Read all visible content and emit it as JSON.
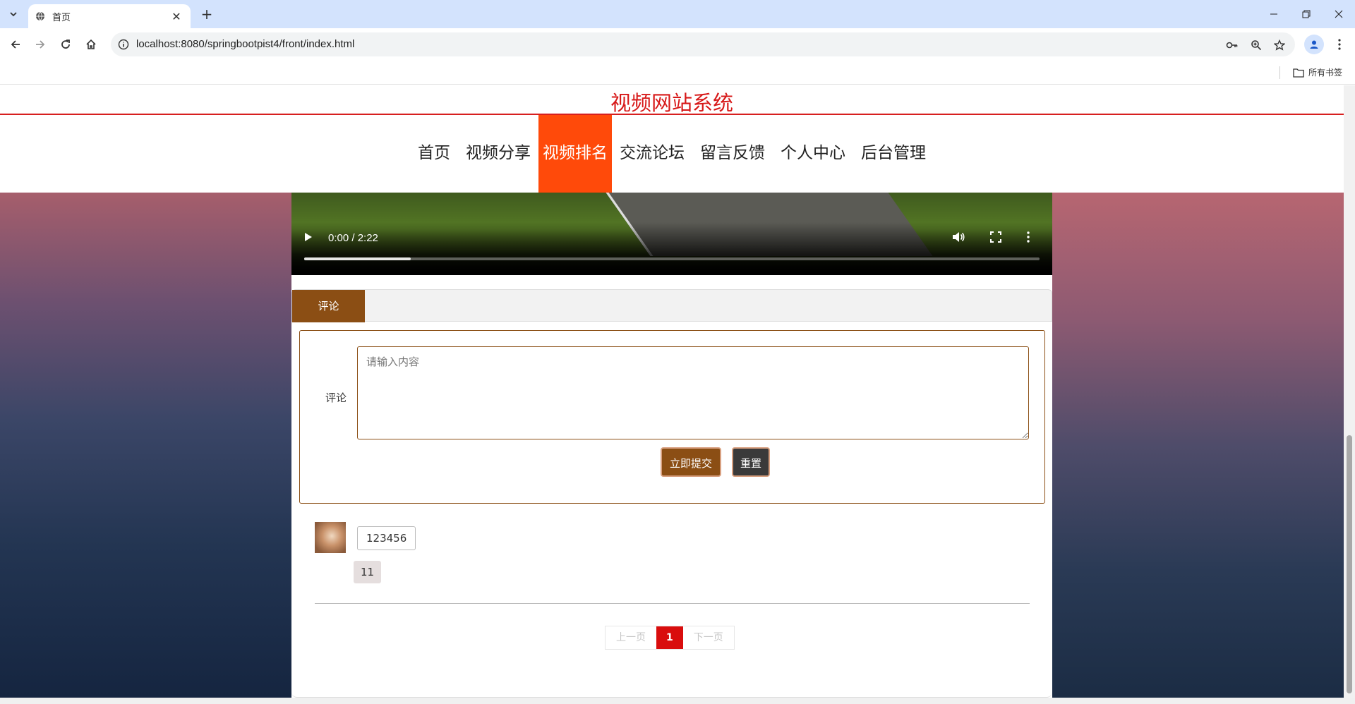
{
  "browser": {
    "tab_title": "首页",
    "url": "localhost:8080/springbootpist4/front/index.html",
    "bookmarks_all": "所有书签"
  },
  "site": {
    "title": "视频网站系统",
    "nav": [
      {
        "label": "首页",
        "active": false
      },
      {
        "label": "视频分享",
        "active": false
      },
      {
        "label": "视频排名",
        "active": true
      },
      {
        "label": "交流论坛",
        "active": false
      },
      {
        "label": "留言反馈",
        "active": false
      },
      {
        "label": "个人中心",
        "active": false
      },
      {
        "label": "后台管理",
        "active": false
      }
    ]
  },
  "video": {
    "time": "0:00 / 2:22",
    "buffered": 0.145
  },
  "comments_section": {
    "tab_label": "评论",
    "form_label": "评论",
    "textarea_placeholder": "请输入内容",
    "submit_label": "立即提交",
    "reset_label": "重置",
    "items": [
      {
        "username": "123456",
        "text": "11"
      }
    ]
  },
  "pager": {
    "prev": "上一页",
    "current": "1",
    "next": "下一页"
  },
  "colors": {
    "brand_red": "#d71818",
    "nav_active": "#ff4a0a",
    "accent_brown": "#8b4e14",
    "pager_active": "#d90d0d"
  }
}
